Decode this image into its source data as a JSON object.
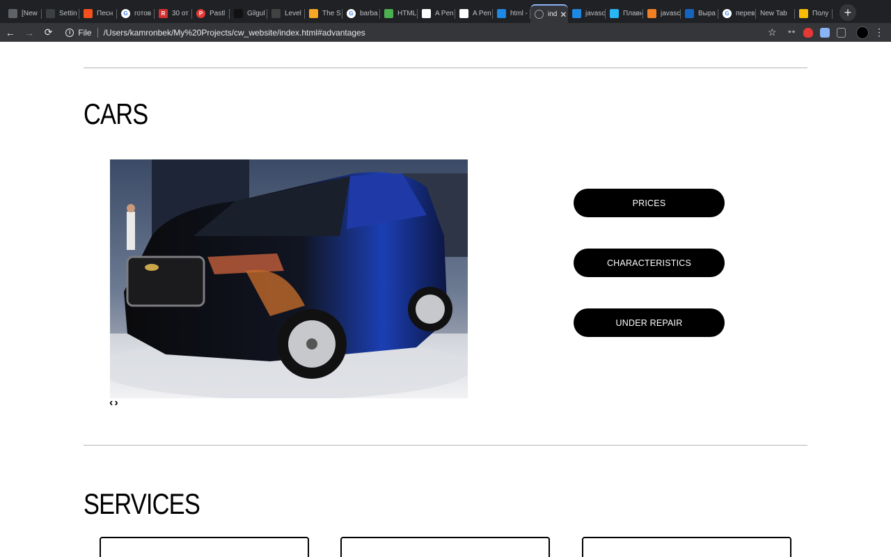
{
  "browser": {
    "tabs": [
      {
        "title": "[New",
        "icon": "braces-icon",
        "color": "#5f6368"
      },
      {
        "title": "Settin",
        "icon": "ampersand-icon",
        "color": "#3c4043"
      },
      {
        "title": "Песн",
        "icon": "music-icon",
        "color": "#f4511e"
      },
      {
        "title": "готов",
        "icon": "google-icon",
        "color": "#ffffff"
      },
      {
        "title": "30 от",
        "icon": "r-icon",
        "color": "#d32f2f"
      },
      {
        "title": "Pastl",
        "icon": "p-icon",
        "color": "#e53935"
      },
      {
        "title": "Gilgul",
        "icon": "g-icon",
        "color": "#111111"
      },
      {
        "title": "Level",
        "icon": "v-icon",
        "color": "#424242"
      },
      {
        "title": "The S",
        "icon": "square-icon",
        "color": "#f9a825"
      },
      {
        "title": "barba",
        "icon": "google-icon",
        "color": "#ffffff"
      },
      {
        "title": "HTML",
        "icon": "html-icon",
        "color": "#4caf50"
      },
      {
        "title": "A Pen",
        "icon": "codepen-icon",
        "color": "#ffffff"
      },
      {
        "title": "A Pen",
        "icon": "codepen-icon",
        "color": "#ffffff"
      },
      {
        "title": "html -",
        "icon": "stack-icon",
        "color": "#1e88e5"
      },
      {
        "title": "ind",
        "icon": "globe-icon",
        "color": "#5f6368",
        "active": true
      },
      {
        "title": "javasc",
        "icon": "stack-icon",
        "color": "#1e88e5"
      },
      {
        "title": "Плавн",
        "icon": "square-icon",
        "color": "#29b6f6"
      },
      {
        "title": "javasc",
        "icon": "stackoverflow-icon",
        "color": "#f48024"
      },
      {
        "title": "Выра",
        "icon": "puzzle-icon",
        "color": "#1565c0"
      },
      {
        "title": "перев",
        "icon": "google-icon",
        "color": "#ffffff"
      },
      {
        "title": "New Tab",
        "icon": "",
        "color": ""
      },
      {
        "title": "Полу",
        "icon": "photos-icon",
        "color": "#fbbc04"
      }
    ],
    "nav": {
      "back": "←",
      "forward": "→",
      "reload": "⟳"
    },
    "omnibox": {
      "scheme": "File",
      "url": "/Users/kamronbek/My%20Projects/cw_website/index.html#advantages"
    }
  },
  "page": {
    "cars_heading": "CARS",
    "services_heading": "SERVICES",
    "slider": {
      "prev": "‹",
      "next": "›"
    },
    "buttons": {
      "prices": "PRICES",
      "characteristics": "CHARACTERISTICS",
      "under_repair": "UNDER REPAIR"
    }
  }
}
